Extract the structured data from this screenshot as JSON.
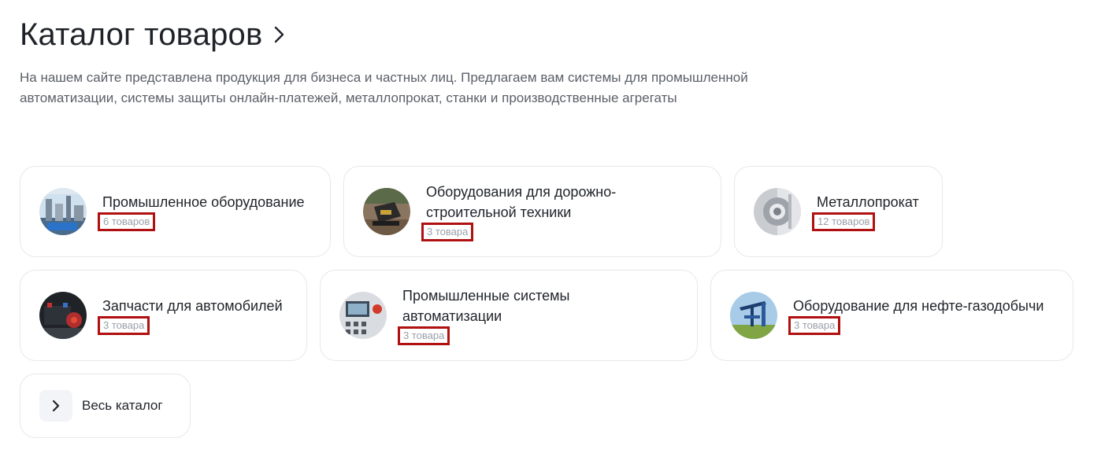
{
  "header": {
    "title": "Каталог товаров",
    "description": "На нашем сайте представлена продукция для бизнеса и частных лиц. Предлагаем вам системы для промышленной автоматизации, системы защиты онлайн-платежей, металлопрокат, станки и производственные агрегаты"
  },
  "categories": [
    {
      "title": "Промышленное оборудование",
      "count": "6 товаров",
      "icon": "industrial-plant-image"
    },
    {
      "title": "Оборудования для дорожно-строительной техники",
      "count": "3 товара",
      "icon": "road-machinery-image"
    },
    {
      "title": "Металлопрокат",
      "count": "12 товаров",
      "icon": "metal-part-image"
    },
    {
      "title": "Запчасти для автомобилей",
      "count": "3 товара",
      "icon": "car-parts-image"
    },
    {
      "title": "Промышленные системы автоматизации",
      "count": "3 товара",
      "icon": "control-panel-image"
    },
    {
      "title": "Оборудование для нефте-газодобычи",
      "count": "3 товара",
      "icon": "oil-pump-image"
    }
  ],
  "all_catalog": {
    "label": "Весь каталог",
    "icon": "chevron-right-icon"
  },
  "colors": {
    "highlight_border": "#b01010",
    "card_border": "#e6e8ec",
    "muted_text": "#9aa0a8"
  }
}
